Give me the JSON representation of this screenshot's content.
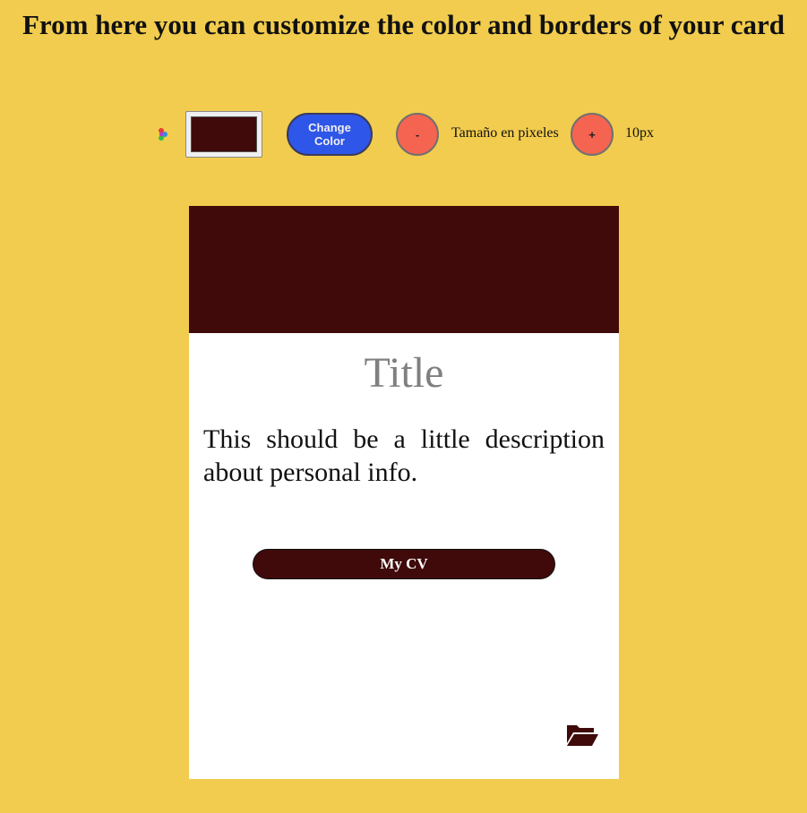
{
  "heading": "From here you can customize the color and borders of your card",
  "controls": {
    "palette_icon": "palette-icon",
    "selected_color": "#400a0a",
    "change_color_label": "Change Color",
    "minus_label": "-",
    "size_label": "Tamaño en pixeles",
    "plus_label": "+",
    "size_value": "10px"
  },
  "card": {
    "title": "Title",
    "description": "This should be a little description about personal info.",
    "cv_button_label": "My CV",
    "folder_icon": "folder-open-icon"
  },
  "colors": {
    "page_background": "#f2cc4e",
    "card_accent": "#400a0a",
    "change_color_button": "#2e56e8",
    "round_buttons": "#f56450"
  }
}
